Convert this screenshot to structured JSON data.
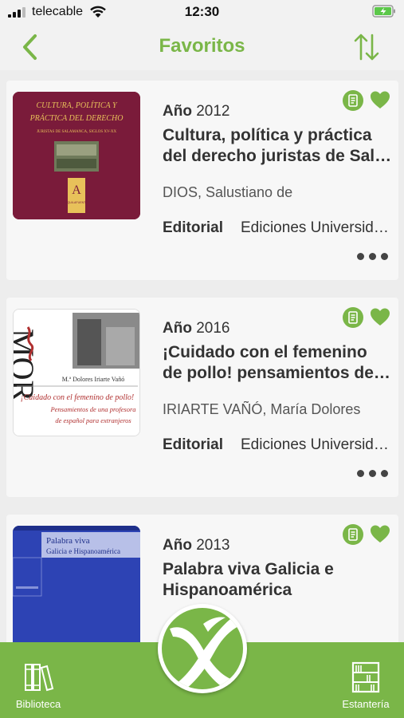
{
  "status_bar": {
    "carrier": "telecable",
    "time": "12:30"
  },
  "nav": {
    "title": "Favoritos"
  },
  "favorites": [
    {
      "year_label": "Año",
      "year": "2012",
      "title_line1": "Cultura, política y práctica",
      "title_line2": "del derecho juristas de Salamanca",
      "author": "DIOS, Salustiano de",
      "editorial_label": "Editorial",
      "editorial": "Ediciones Universidad de Salamanca",
      "cover": {
        "title_l1": "CULTURA, POLÍTICA Y",
        "title_l2": "PRÁCTICA DEL DERECHO",
        "subtitle": "JURISTAS DE SALAMANCA, SIGLOS XV-XX",
        "logo": "AQUILAFUENTE"
      }
    },
    {
      "year_label": "Año",
      "year": "2016",
      "title_line1": "¡Cuidado con el femenino",
      "title_line2": "de pollo! pensamientos de una profesora",
      "author": "IRIARTE VAÑÓ, María Dolores",
      "editorial_label": "Editorial",
      "editorial": "Ediciones Universidad de Salamanca",
      "cover": {
        "series": "MOR",
        "author": "M.ª Dolores Iriarte Vañó",
        "title_l1": "¡Cuidado con el femenino de pollo!",
        "title_l2": "Pensamientos de una profesora",
        "title_l3": "de español para extranjeros"
      }
    },
    {
      "year_label": "Año",
      "year": "2013",
      "title_line1": "Palabra viva Galicia e",
      "title_line2": "Hispanoamérica",
      "cover": {
        "title_l1": "Palabra viva",
        "title_l2": "Galicia e Hispanoamérica"
      }
    }
  ],
  "tabs": {
    "left": "Biblioteca",
    "right": "Estantería"
  },
  "colors": {
    "accent": "#7ab648",
    "background": "#ededed",
    "card": "#f7f7f7"
  },
  "icons": [
    "back-chevron-icon",
    "sort-arrows-icon",
    "document-icon",
    "heart-icon",
    "more-dots-icon",
    "books-icon",
    "bookshelf-icon",
    "app-logo-icon"
  ]
}
